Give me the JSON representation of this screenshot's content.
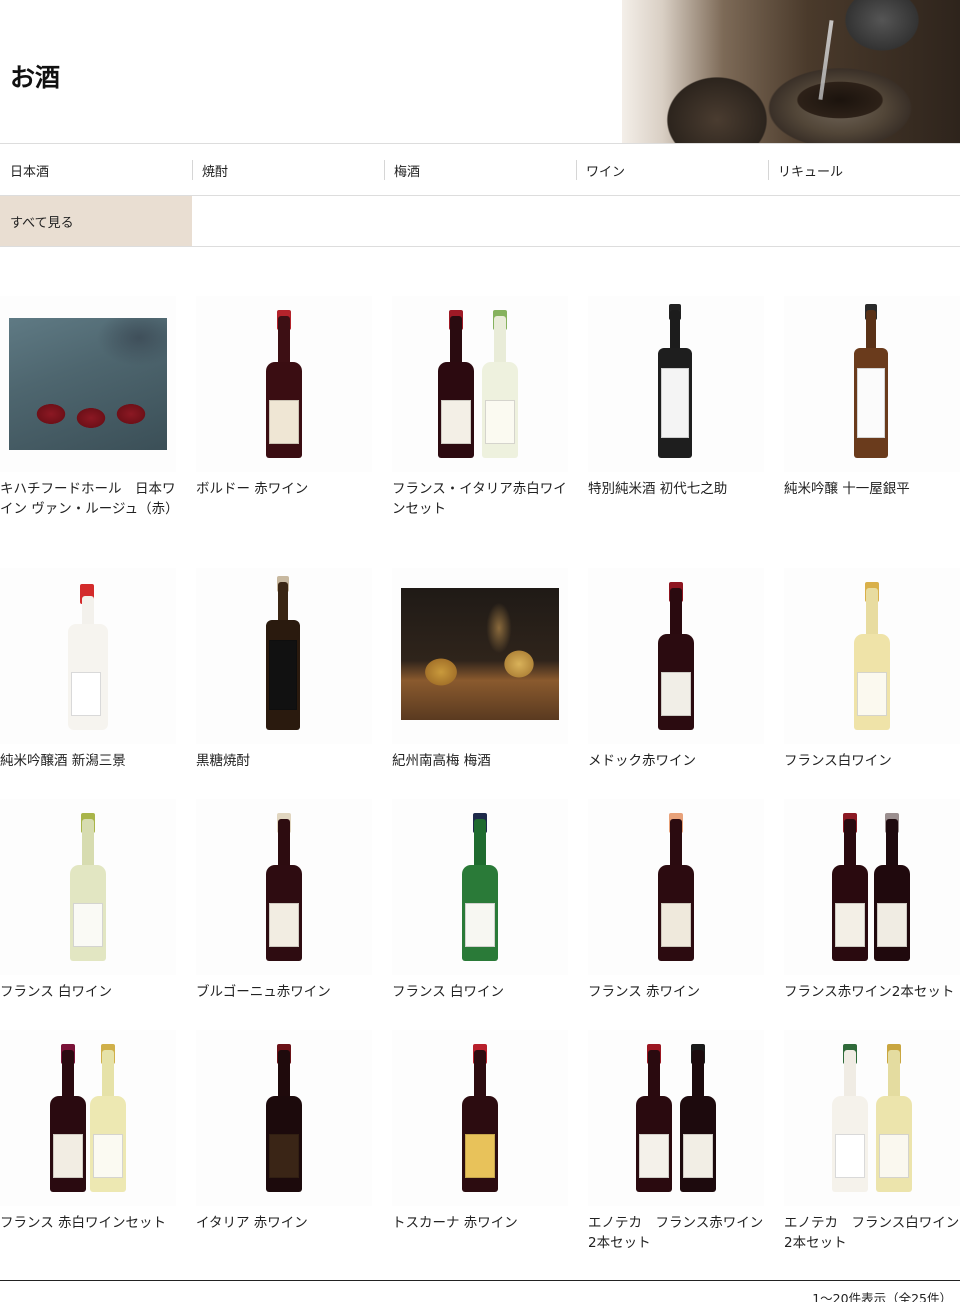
{
  "hero": {
    "title": "お酒"
  },
  "categories": [
    "日本酒",
    "焼酎",
    "梅酒",
    "ワイン",
    "リキュール"
  ],
  "sub_nav": {
    "all_label": "すべて見る"
  },
  "products": [
    {
      "name": "キハチフードホール　日本ワイン ヴァン・ルージュ（赤）",
      "kind": "photo-wine"
    },
    {
      "name": "ボルドー 赤ワイン",
      "kind": "bottles"
    },
    {
      "name": "フランス・イタリア赤白ワインセット",
      "kind": "bottles"
    },
    {
      "name": "特別純米酒 初代七之助",
      "kind": "bottles"
    },
    {
      "name": "純米吟醸 十一屋銀平",
      "kind": "bottles"
    },
    {
      "name": "純米吟醸酒 新潟三景",
      "kind": "bottles"
    },
    {
      "name": "黒糖焼酎",
      "kind": "bottles"
    },
    {
      "name": "紀州南高梅 梅酒",
      "kind": "photo-umeshu"
    },
    {
      "name": "メドック赤ワイン",
      "kind": "bottles"
    },
    {
      "name": "フランス白ワイン",
      "kind": "bottles"
    },
    {
      "name": "フランス 白ワイン",
      "kind": "bottles"
    },
    {
      "name": "ブルゴーニュ赤ワイン",
      "kind": "bottles"
    },
    {
      "name": "フランス 白ワイン",
      "kind": "bottles"
    },
    {
      "name": "フランス 赤ワイン",
      "kind": "bottles"
    },
    {
      "name": "フランス赤ワイン2本セット",
      "kind": "bottles"
    },
    {
      "name": "フランス 赤白ワインセット",
      "kind": "bottles"
    },
    {
      "name": "イタリア 赤ワイン",
      "kind": "bottles"
    },
    {
      "name": "トスカーナ 赤ワイン",
      "kind": "bottles"
    },
    {
      "name": "エノテカ　フランス赤ワイン2本セット",
      "kind": "bottles"
    },
    {
      "name": "エノテカ　フランス白ワイン2本セット",
      "kind": "bottles"
    }
  ],
  "pager": {
    "summary": "1〜20件表示（全25件）"
  }
}
